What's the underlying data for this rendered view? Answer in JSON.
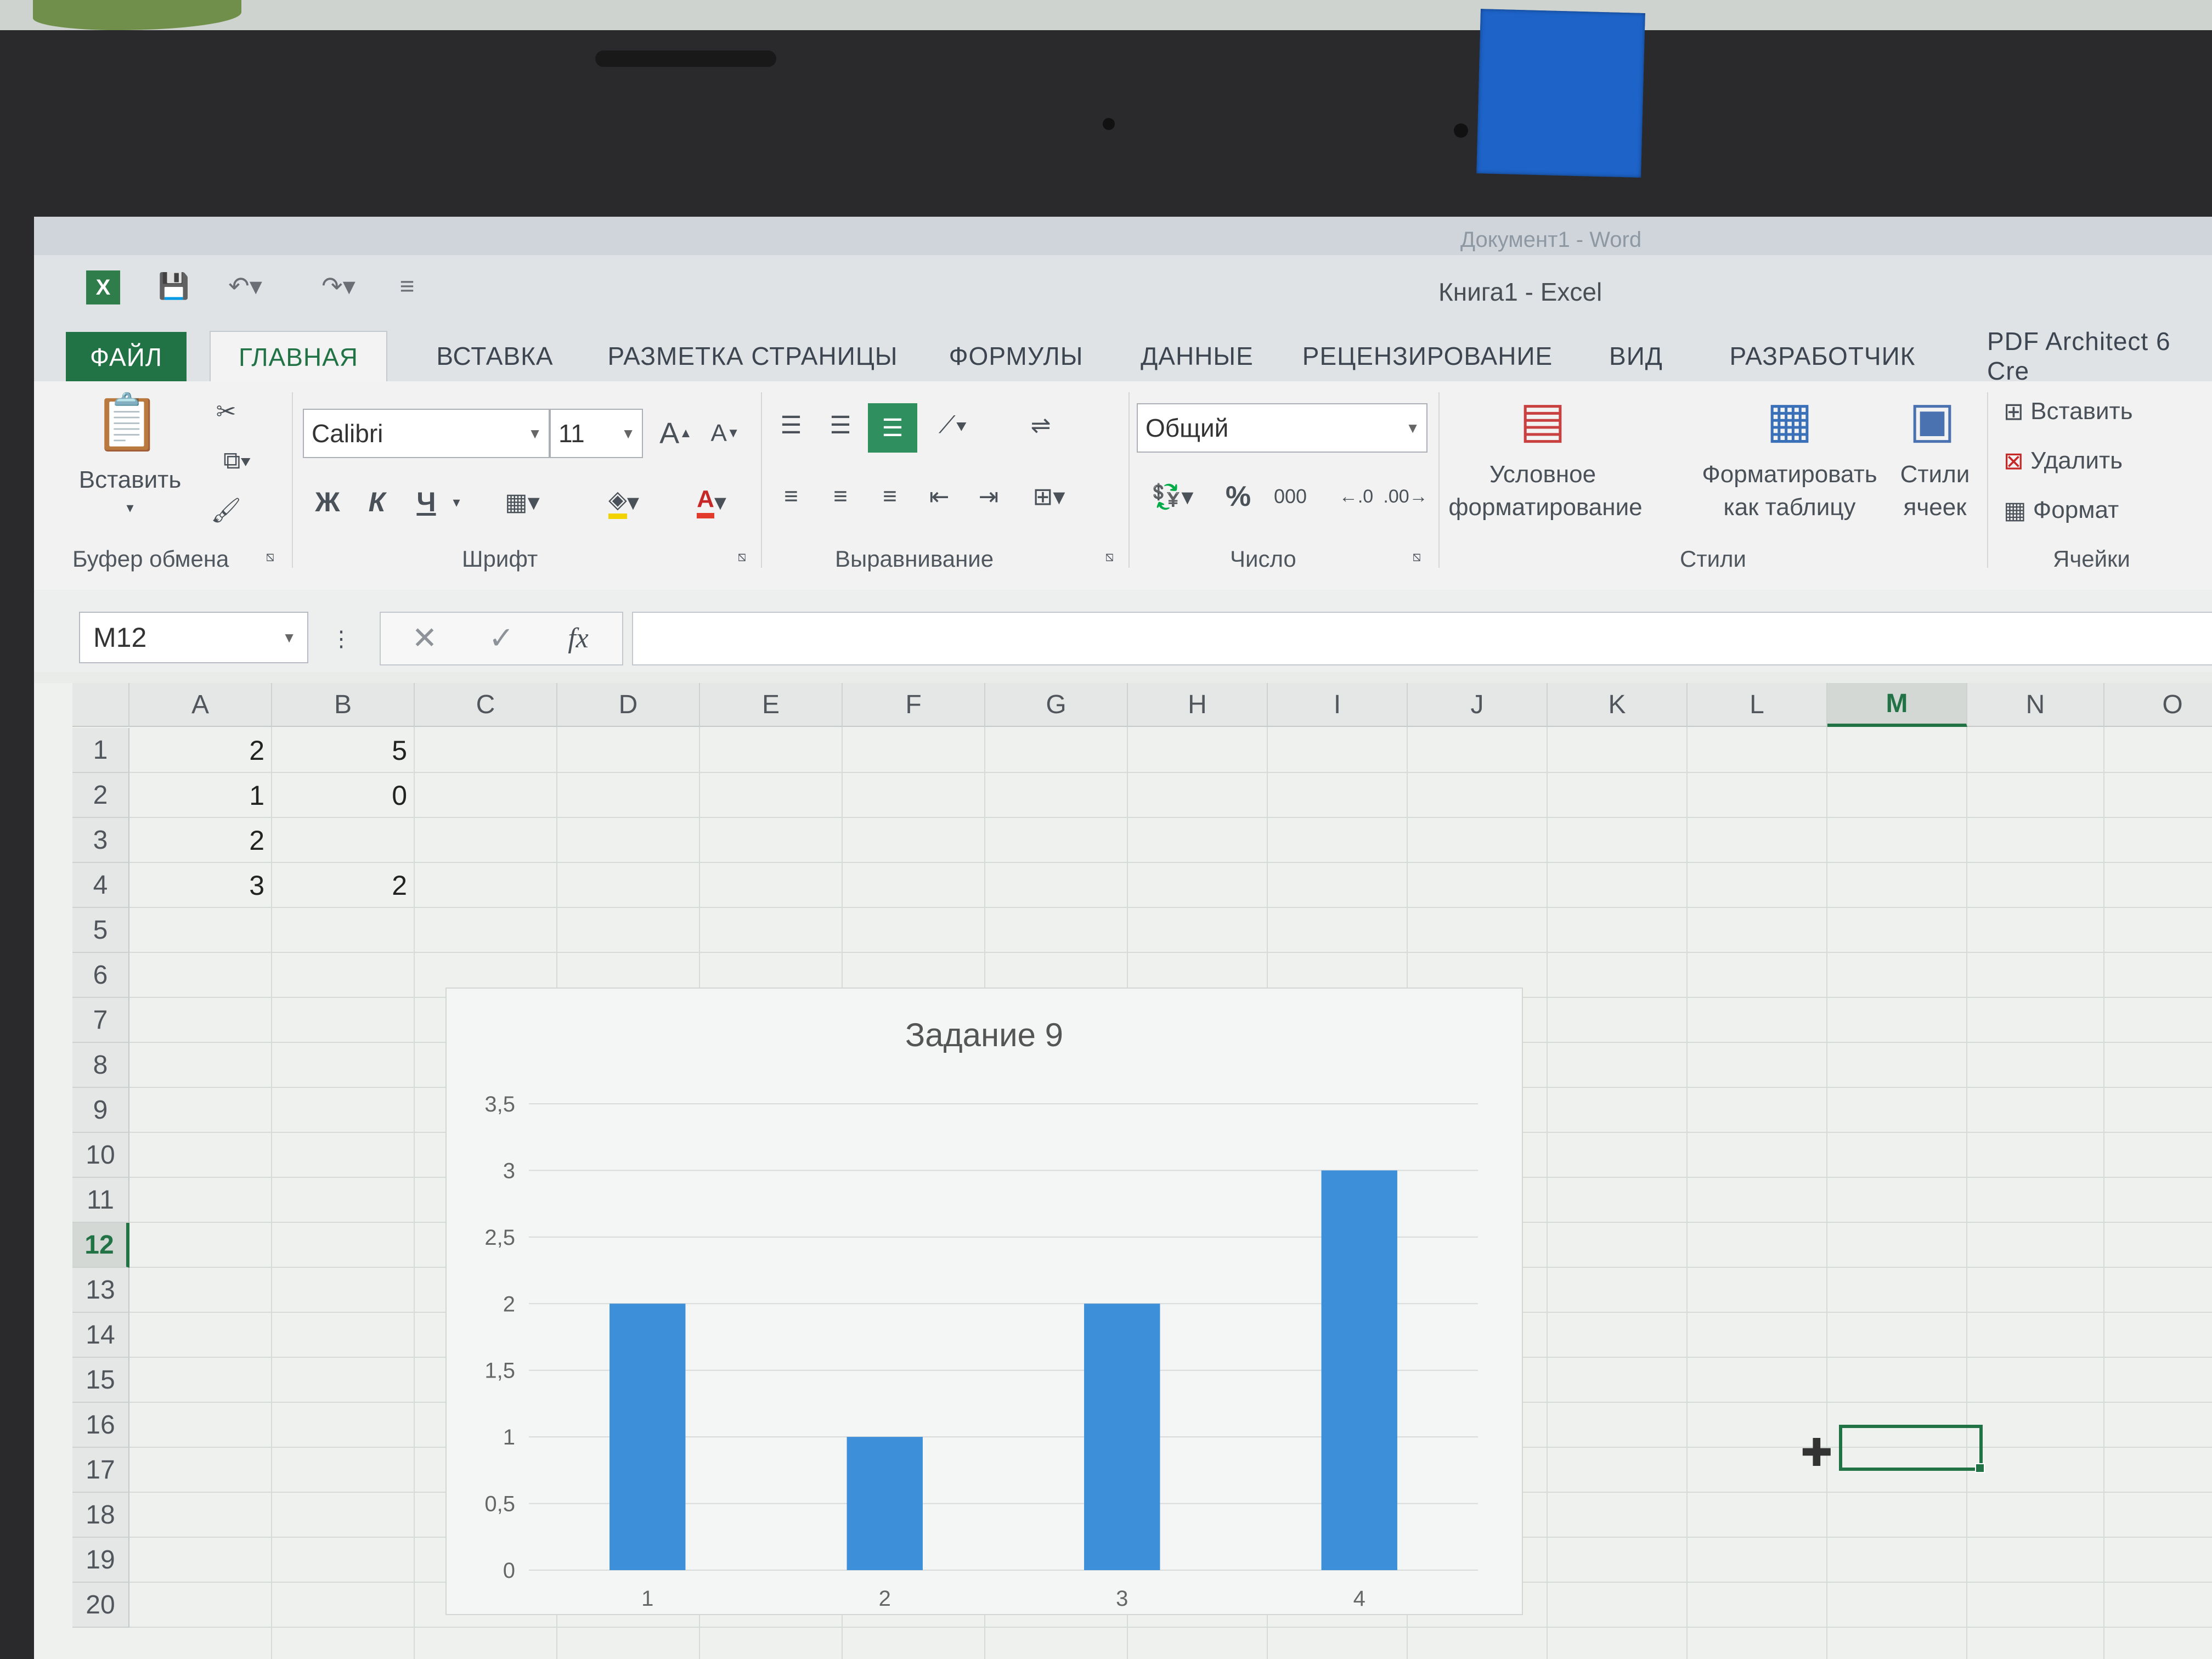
{
  "window": {
    "title": "Книга1 - Excel",
    "background_title": "Документ1 - Word"
  },
  "tabs": [
    {
      "label": "ФАЙЛ"
    },
    {
      "label": "ГЛАВНАЯ"
    },
    {
      "label": "ВСТАВКА"
    },
    {
      "label": "РАЗМЕТКА СТРАНИЦЫ"
    },
    {
      "label": "ФОРМУЛЫ"
    },
    {
      "label": "ДАННЫЕ"
    },
    {
      "label": "РЕЦЕНЗИРОВАНИЕ"
    },
    {
      "label": "ВИД"
    },
    {
      "label": "РАЗРАБОТЧИК"
    },
    {
      "label": "PDF Architect 6 Cre"
    }
  ],
  "ribbon": {
    "clipboard": {
      "paste": "Вставить",
      "label": "Буфер обмена"
    },
    "font": {
      "name": "Calibri",
      "size": "11",
      "bold": "Ж",
      "italic": "К",
      "underline": "Ч",
      "label": "Шрифт"
    },
    "alignment": {
      "label": "Выравнивание"
    },
    "number": {
      "format": "Общий",
      "percent": "%",
      "thousands": "000",
      "label": "Число"
    },
    "styles": {
      "conditional_1": "Условное",
      "conditional_2": "форматирование",
      "format_table_1": "Форматировать",
      "format_table_2": "как таблицу",
      "cell_styles_1": "Стили",
      "cell_styles_2": "ячеек",
      "label": "Стили"
    },
    "cells": {
      "insert": "Вставить",
      "delete": "Удалить",
      "format": "Формат",
      "label": "Ячейки"
    }
  },
  "formula_bar": {
    "name_box": "M12",
    "fx": "fx",
    "value": ""
  },
  "grid": {
    "columns": [
      "A",
      "B",
      "C",
      "D",
      "E",
      "F",
      "G",
      "H",
      "I",
      "J",
      "K",
      "L",
      "M",
      "N",
      "O"
    ],
    "rows": [
      "1",
      "2",
      "3",
      "4",
      "5",
      "6",
      "7",
      "8",
      "9",
      "10",
      "11",
      "12",
      "13",
      "14",
      "15",
      "16",
      "17",
      "18",
      "19",
      "20"
    ],
    "selected_column": "M",
    "selected_row": "12",
    "cells": {
      "A1": "2",
      "B1": "5",
      "A2": "1",
      "B2": "0",
      "A3": "2",
      "A4": "3",
      "B4": "2"
    }
  },
  "chart_data": {
    "type": "bar",
    "title": "Задание 9",
    "categories": [
      "1",
      "2",
      "3",
      "4"
    ],
    "values": [
      2,
      1,
      2,
      3
    ],
    "ylim": [
      0,
      3.5
    ],
    "yticks": [
      "0",
      "0,5",
      "1",
      "1,5",
      "2",
      "2,5",
      "3",
      "3,5"
    ],
    "bar_color": "#3c8fd8",
    "grid": true
  }
}
